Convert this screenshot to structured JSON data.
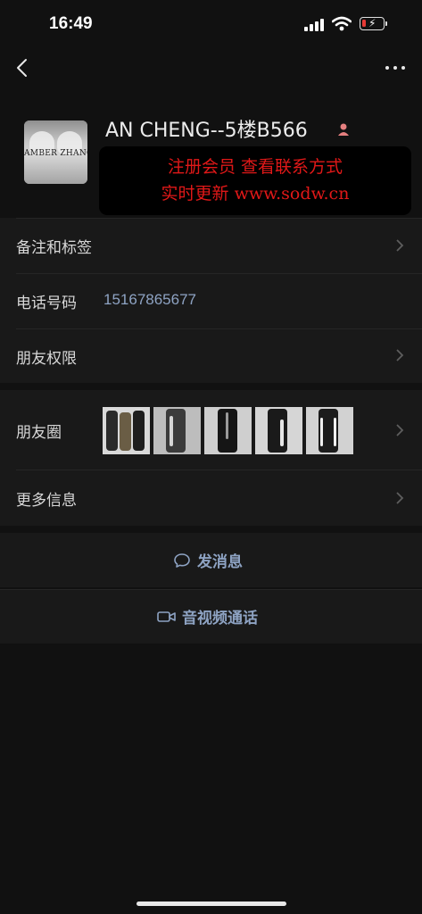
{
  "status_bar": {
    "time": "16:49",
    "battery_level": 0.2,
    "battery_color": "#e53935"
  },
  "nav": {
    "back_icon": "chevron-left-icon",
    "more_icon": "more-dots-icon"
  },
  "profile": {
    "avatar_text": "AMBER ZHANG",
    "name": "AN CHENG--5楼B566",
    "gender_icon": "person-icon",
    "promo_line1": "注册会员 查看联系方式",
    "promo_line2": "实时更新 www.sodw.cn",
    "promo_color": "#e01818"
  },
  "rows": {
    "remarks": {
      "label": "备注和标签"
    },
    "phone": {
      "label": "电话号码",
      "value": "15167865677"
    },
    "permissions": {
      "label": "朋友权限"
    },
    "moments": {
      "label": "朋友圈",
      "thumbnail_count": 5
    },
    "more_info": {
      "label": "更多信息"
    }
  },
  "actions": {
    "message": {
      "label": "发消息",
      "icon": "chat-bubble-icon"
    },
    "call": {
      "label": "音视频通话",
      "icon": "video-camera-icon"
    }
  },
  "colors": {
    "background": "#111111",
    "row_background": "#191919",
    "accent_link": "#8ea3c3"
  }
}
